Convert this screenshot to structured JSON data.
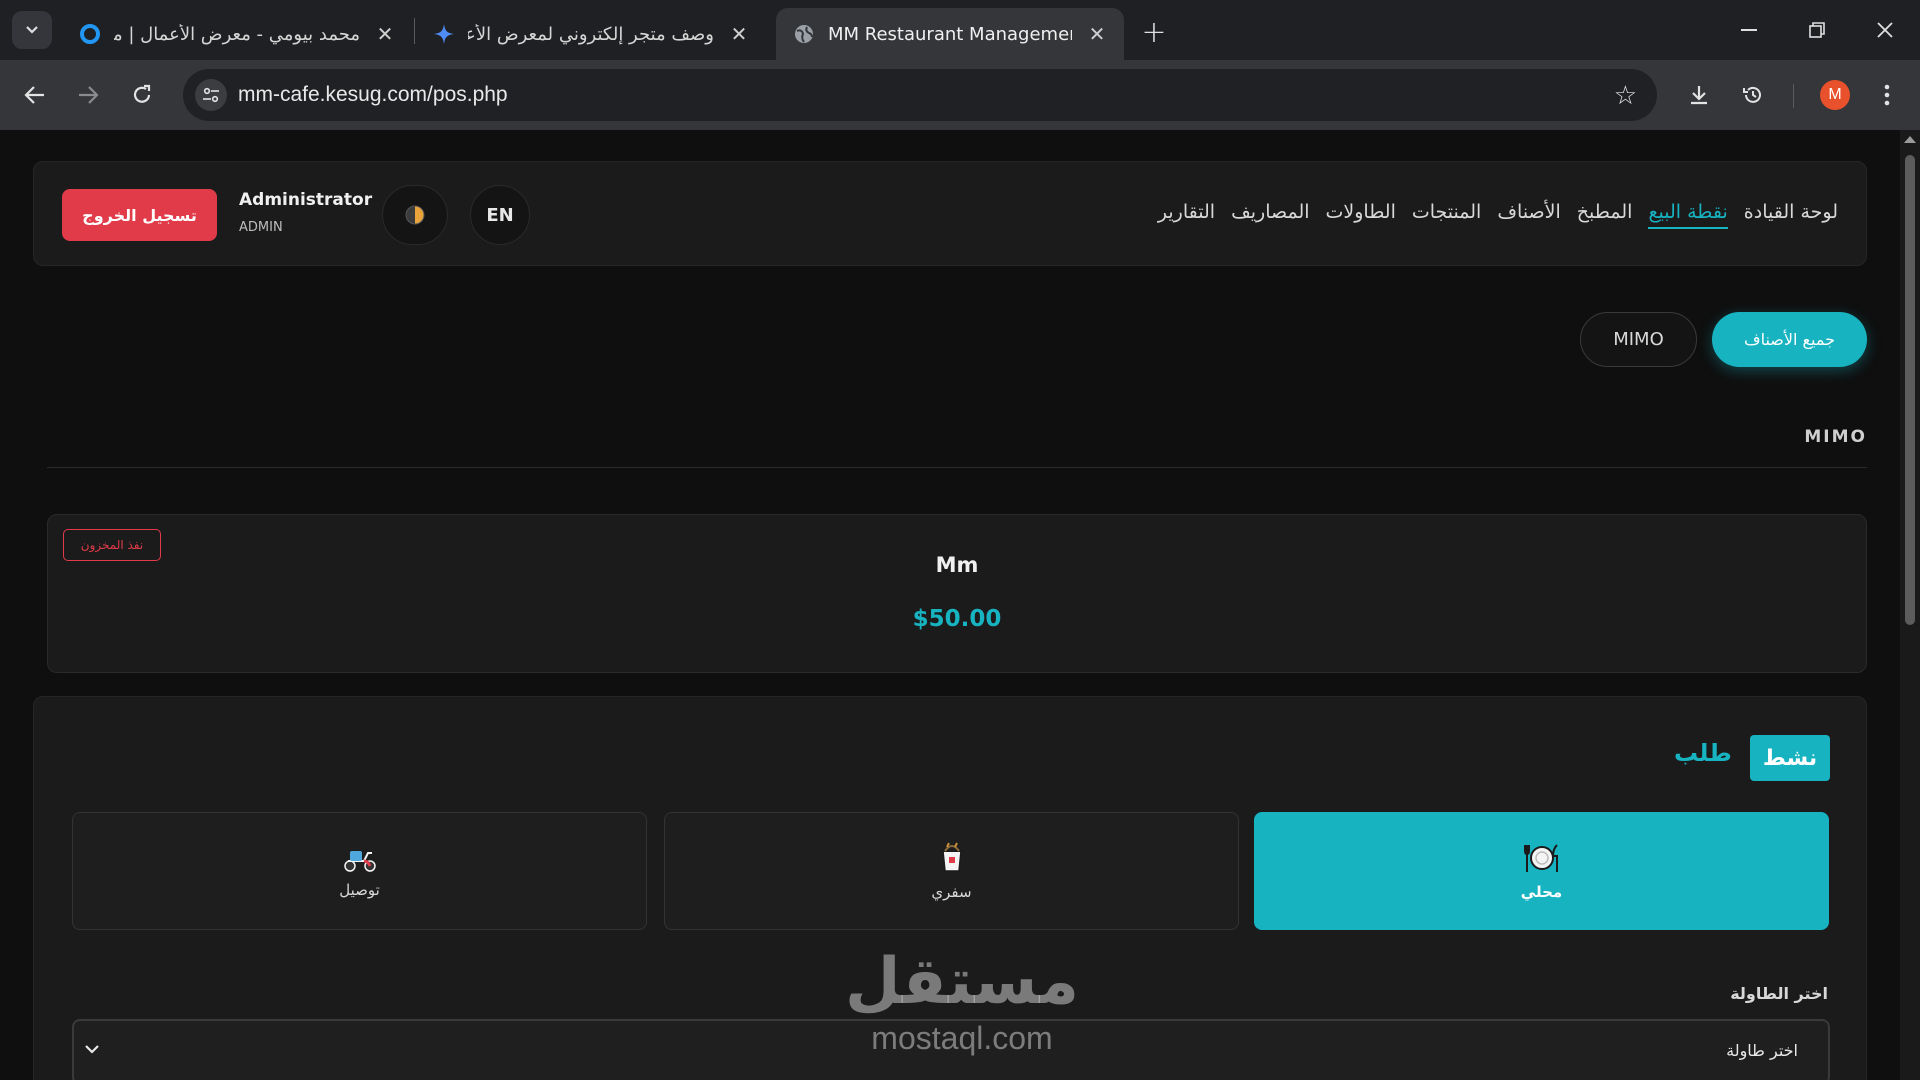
{
  "browser": {
    "tabs": [
      {
        "title": "محمد بيومي - معرض الأعمال | مس",
        "icon": "circle-logo-icon"
      },
      {
        "title": "وصف متجر إلكتروني لمعرض الأعمال",
        "icon": "sparkle-icon"
      },
      {
        "title": "MM Restaurant Management",
        "icon": "globe-icon",
        "active": true
      }
    ],
    "url": "mm-cafe.kesug.com/pos.php",
    "profile_initial": "M"
  },
  "header": {
    "nav": [
      "لوحة القيادة",
      "نقطة البيع",
      "المطبخ",
      "الأصناف",
      "المنتجات",
      "الطاولات",
      "المصاريف",
      "التقارير"
    ],
    "active_nav": "نقطة البيع",
    "lang": "EN",
    "user_name": "Administrator",
    "user_role": "ADMIN",
    "logout": "تسجيل الخروج"
  },
  "categories": {
    "all": "جميع الأصناف",
    "mimo": "MIMO"
  },
  "section": {
    "title": "MIMO"
  },
  "product": {
    "badge": "نفذ المخزون",
    "name": "Mm",
    "price": "$50.00"
  },
  "order": {
    "status": "نشط",
    "title": "طلب",
    "types": [
      {
        "label": "محلي",
        "icon": "plate-icon"
      },
      {
        "label": "سفري",
        "icon": "takeaway-box-icon"
      },
      {
        "label": "توصيل",
        "icon": "scooter-icon"
      }
    ],
    "table_label": "اختر الطاولة",
    "table_value": "اختر طاولة"
  },
  "watermark": {
    "arabic": "مستقل",
    "latin": "mostaql.com"
  },
  "colors": {
    "accent": "#17b3c1",
    "danger": "#e13a48",
    "background": "#0f0f0f",
    "card": "#1b1b1b"
  }
}
